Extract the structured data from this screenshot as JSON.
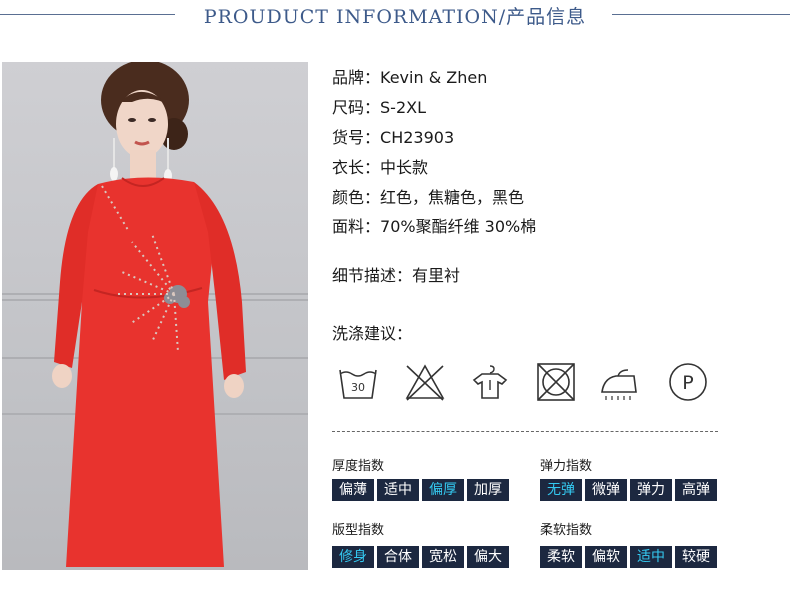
{
  "header": {
    "title": "PROUDUCT INFORMATION/产品信息"
  },
  "specs": [
    {
      "key": "品牌：",
      "value": "Kevin & Zhen"
    },
    {
      "key": "尺码：",
      "value": "S-2XL"
    },
    {
      "key": "货号：",
      "value": "CH23903"
    },
    {
      "key": "衣长：",
      "value": "中长款"
    },
    {
      "key": "颜色：",
      "value": "红色，焦糖色，黑色"
    },
    {
      "key": "面料：",
      "value": "70%聚酯纤维 30%棉"
    }
  ],
  "detail": {
    "key": "细节描述：",
    "value": "有里衬"
  },
  "care": {
    "label": "洗涤建议：",
    "icons": [
      "wash-30-icon",
      "no-bleach-icon",
      "hang-dry-icon",
      "no-tumble-dry-icon",
      "iron-icon",
      "dry-clean-p-icon"
    ],
    "wash_temp": "30",
    "dry_clean_letter": "P"
  },
  "indices": {
    "thickness": {
      "title": "厚度指数",
      "options": [
        "偏薄",
        "适中",
        "偏厚",
        "加厚"
      ],
      "selected": "偏厚"
    },
    "elasticity": {
      "title": "弹力指数",
      "options": [
        "无弹",
        "微弹",
        "弹力",
        "高弹"
      ],
      "selected": "无弹"
    },
    "fit": {
      "title": "版型指数",
      "options": [
        "修身",
        "合体",
        "宽松",
        "偏大"
      ],
      "selected": "修身"
    },
    "softness": {
      "title": "柔软指数",
      "options": [
        "柔软",
        "偏软",
        "适中",
        "较硬"
      ],
      "selected": "适中"
    }
  },
  "colors": {
    "accent": "#3d5a8a",
    "chip_bg": "#1c2840",
    "chip_selected_text": "#34c9f0",
    "dress": "#e8332e"
  }
}
